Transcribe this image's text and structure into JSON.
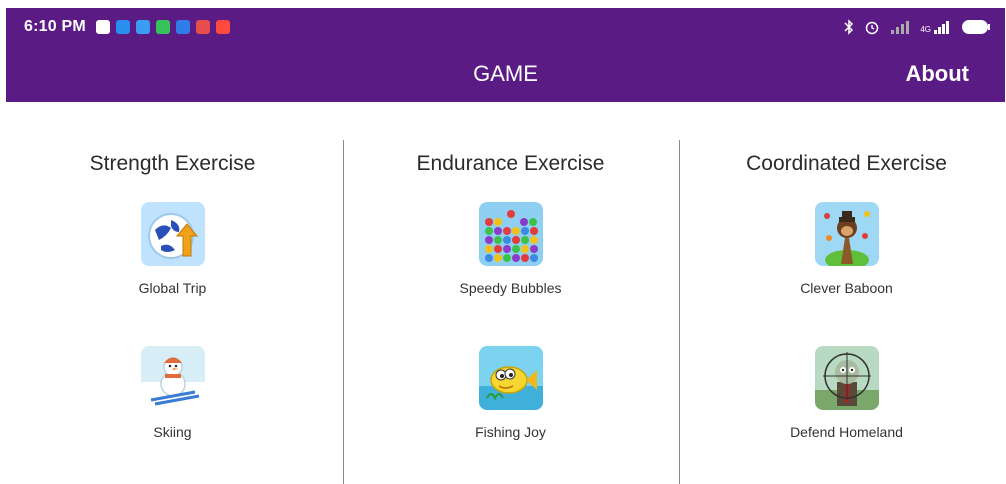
{
  "status_bar": {
    "time": "6:10 PM",
    "notification_icons": [
      "message-icon",
      "map-pin-icon",
      "tv-icon",
      "wechat-icon",
      "translate-icon",
      "chart-icon",
      "taobao-icon"
    ],
    "right_icons": [
      "bluetooth-icon",
      "alarm-icon",
      "signal-icon",
      "signal-4g-icon",
      "battery-icon"
    ],
    "network": "4G"
  },
  "app_bar": {
    "title": "GAME",
    "about_label": "About",
    "color": "#5a1b85"
  },
  "columns": [
    {
      "title": "Strength Exercise",
      "games": [
        {
          "name": "Global Trip",
          "icon": "globe-arrow-icon"
        },
        {
          "name": "Skiing",
          "icon": "snowman-skier-icon"
        }
      ]
    },
    {
      "title": "Endurance Exercise",
      "games": [
        {
          "name": "Speedy Bubbles",
          "icon": "bubbles-icon"
        },
        {
          "name": "Fishing Joy",
          "icon": "fish-icon"
        }
      ]
    },
    {
      "title": "Coordinated Exercise",
      "games": [
        {
          "name": "Clever Baboon",
          "icon": "baboon-icon"
        },
        {
          "name": "Defend Homeland",
          "icon": "zombie-target-icon"
        }
      ]
    }
  ]
}
